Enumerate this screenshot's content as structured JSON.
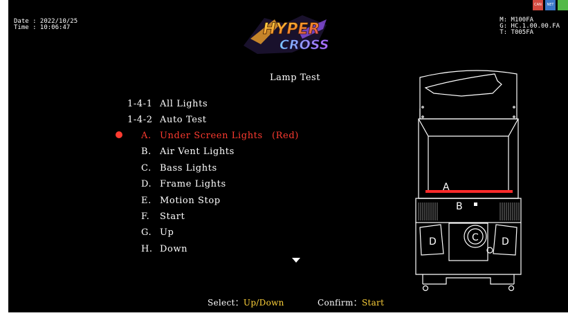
{
  "header": {
    "date": "Date : 2022/10/25",
    "time": "Time : 10:06:47",
    "machine": {
      "m": "M: M100FA",
      "g": "G: HC.1.00.00.FA",
      "t": "T: T005FA"
    },
    "badges": [
      {
        "label": "CAN",
        "color": "#d4493f"
      },
      {
        "label": "NET",
        "color": "#3a78c9"
      },
      {
        "label": "",
        "color": "#53b948"
      }
    ]
  },
  "logo": {
    "text_top": "HYPER",
    "text_bottom": "CROSS"
  },
  "page_title": "Lamp Test",
  "menu": {
    "top_items": [
      {
        "code": "1-4-1",
        "label": "All Lights"
      },
      {
        "code": "1-4-2",
        "label": "Auto Test"
      }
    ],
    "sub_items": [
      {
        "letter": "A.",
        "label": "Under Screen Lights",
        "value": "(Red)",
        "selected": true
      },
      {
        "letter": "B.",
        "label": "Air Vent Lights",
        "value": "",
        "selected": false
      },
      {
        "letter": "C.",
        "label": "Bass Lights",
        "value": "",
        "selected": false
      },
      {
        "letter": "D.",
        "label": "Frame Lights",
        "value": "",
        "selected": false
      },
      {
        "letter": "E.",
        "label": "Motion Stop",
        "value": "",
        "selected": false
      },
      {
        "letter": "F.",
        "label": "Start",
        "value": "",
        "selected": false
      },
      {
        "letter": "G.",
        "label": "Up",
        "value": "",
        "selected": false
      },
      {
        "letter": "H.",
        "label": "Down",
        "value": "",
        "selected": false
      }
    ],
    "more_indicator": "down-arrow-icon"
  },
  "footer": {
    "select_label": "Select：",
    "select_value": "Up/Down",
    "confirm_label": "Confirm：",
    "confirm_value": "Start"
  },
  "cabinet": {
    "label_a": "A",
    "label_b": "B",
    "label_c": "C",
    "label_d_left": "D",
    "label_d_right": "D"
  },
  "colors": {
    "background": "#000000",
    "text": "#ffffff",
    "selected": "#ff3b30",
    "footer_value": "#ffd23a"
  }
}
